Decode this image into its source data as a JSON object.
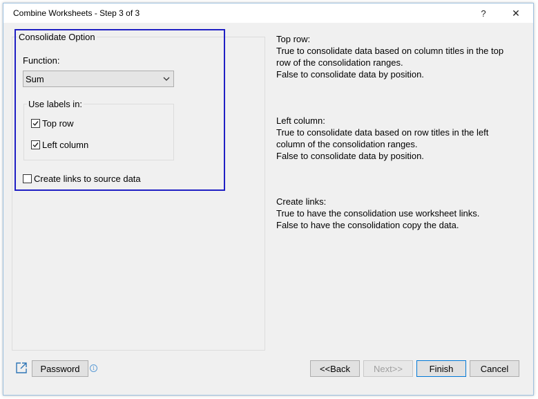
{
  "window": {
    "title": "Combine Worksheets - Step 3 of 3",
    "help_label": "?",
    "close_label": "✕"
  },
  "consolidate": {
    "legend": "Consolidate Option",
    "function_label": "Function:",
    "function_value": "Sum",
    "labels_legend": "Use labels in:",
    "top_row_label": "Top row",
    "top_row_checked": true,
    "left_column_label": "Left column",
    "left_column_checked": true,
    "create_links_label": "Create links to source data",
    "create_links_checked": false,
    "highlight_color": "#1f1fc4"
  },
  "descriptions": {
    "top_row": {
      "title": "Top row:",
      "line1": "True to consolidate data based on column titles in the top",
      "line2": "row of the consolidation ranges.",
      "line3": "False to consolidate data by position."
    },
    "left_column": {
      "title": "Left column:",
      "line1": "True to consolidate data based on row titles in the left",
      "line2": "column of the consolidation ranges.",
      "line3": "False to consolidate data by position."
    },
    "create_links": {
      "title": "Create links:",
      "line1": "True to have the consolidation use worksheet links.",
      "line2": "False to have the consolidation copy the data."
    }
  },
  "footer": {
    "password_label": "Password",
    "back_label": "<<Back",
    "next_label": "Next>>",
    "finish_label": "Finish",
    "cancel_label": "Cancel",
    "info_glyph": "i"
  }
}
